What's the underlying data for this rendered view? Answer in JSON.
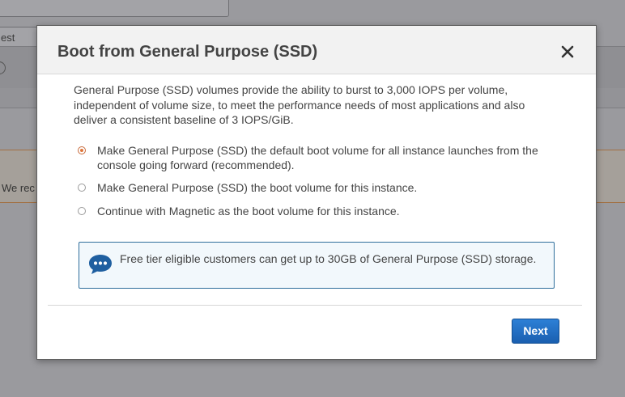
{
  "background": {
    "tab_label": "est",
    "info_icon": "info-icon",
    "warning_text": "We rec"
  },
  "dialog": {
    "title": "Boot from General Purpose (SSD)",
    "close_icon": "close-icon",
    "intro": "General Purpose (SSD) volumes provide the ability to burst to 3,000 IOPS per volume, independent of volume size, to meet the performance needs of most applications and also deliver a consistent baseline of 3 IOPS/GiB.",
    "options": [
      {
        "label": "Make General Purpose (SSD) the default boot volume for all instance launches from the console going forward (recommended).",
        "selected": true
      },
      {
        "label": "Make General Purpose (SSD) the boot volume for this instance.",
        "selected": false
      },
      {
        "label": "Continue with Magnetic as the boot volume for this instance.",
        "selected": false
      }
    ],
    "notice": {
      "icon": "chat-bubble-icon",
      "text": "Free tier eligible customers can get up to 30GB of General Purpose (SSD) storage."
    },
    "next_label": "Next"
  },
  "colors": {
    "primary_button": "#1f6cc3",
    "radio_selected": "#e0763a",
    "notice_border": "#2f6e9b",
    "notice_icon": "#1f5fa0"
  }
}
